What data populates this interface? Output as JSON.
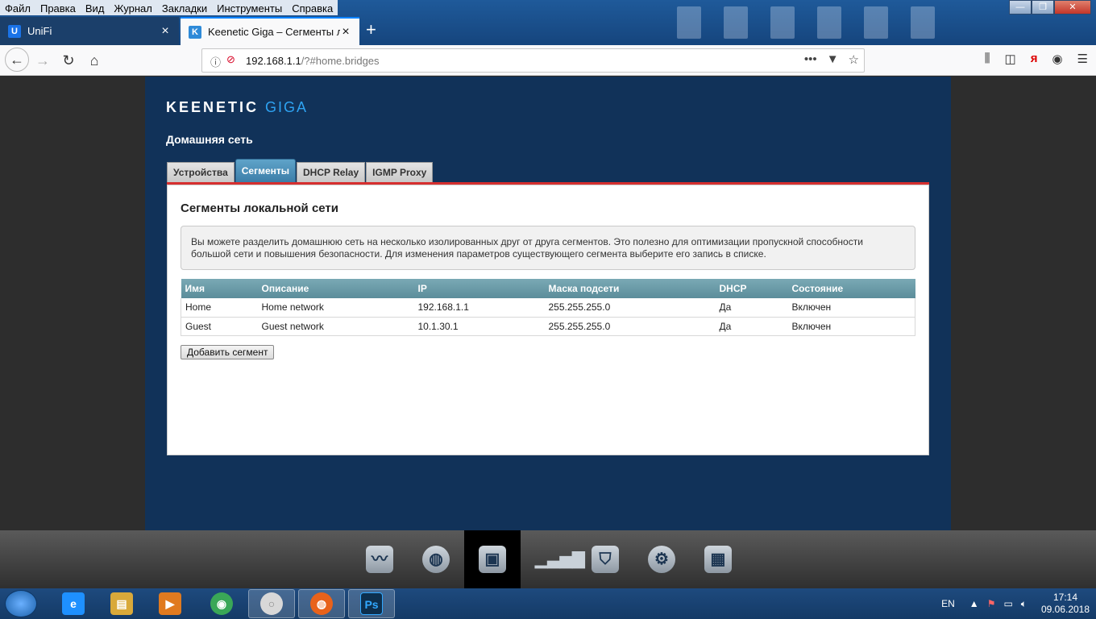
{
  "menubar": {
    "items": [
      "Файл",
      "Правка",
      "Вид",
      "Журнал",
      "Закладки",
      "Инструменты",
      "Справка"
    ]
  },
  "browser": {
    "tabs": [
      {
        "label": "UniFi",
        "icon": "unifi-icon",
        "icon_letter": "U",
        "icon_color": "#1a73e8",
        "active": false
      },
      {
        "label": "Keenetic Giga – Сегменты лока",
        "icon": "keenetic-icon",
        "icon_letter": "K",
        "icon_color": "#2e8ad8",
        "active": true
      }
    ],
    "url_host": "192.168.1.1",
    "url_path": "/?#home.bridges"
  },
  "router": {
    "logo_brand": "KEENETIC",
    "logo_model": "GIGA",
    "section_title": "Домашняя сеть",
    "tabs": [
      "Устройства",
      "Сегменты",
      "DHCP Relay",
      "IGMP Proxy"
    ],
    "active_tab": "Сегменты",
    "panel_title": "Сегменты локальной сети",
    "info_text": "Вы можете разделить домашнюю сеть на несколько изолированных друг от друга сегментов. Это полезно для оптимизации пропускной способности большой сети и повышения безопасности. Для изменения параметров существующего сегмента выберите его запись в списке.",
    "table": {
      "headers": [
        "Имя",
        "Описание",
        "IP",
        "Маска подсети",
        "DHCP",
        "Состояние"
      ],
      "rows": [
        [
          "Home",
          "Home network",
          "192.168.1.1",
          "255.255.255.0",
          "Да",
          "Включен"
        ],
        [
          "Guest",
          "Guest network",
          "10.1.30.1",
          "255.255.255.0",
          "Да",
          "Включен"
        ]
      ]
    },
    "add_button": "Добавить сегмент",
    "accent_color": "#d62f2f",
    "background_color": "#113259"
  },
  "dock": {
    "items": [
      {
        "name": "monitor-chart-icon",
        "active": false
      },
      {
        "name": "internet-globe-icon",
        "active": false
      },
      {
        "name": "home-network-icon",
        "active": true
      },
      {
        "name": "wifi-signal-icon",
        "active": false
      },
      {
        "name": "security-shield-icon",
        "active": false
      },
      {
        "name": "system-gear-icon",
        "active": false
      },
      {
        "name": "apps-grid-icon",
        "active": false
      }
    ]
  },
  "taskbar": {
    "apps": [
      {
        "name": "internet-explorer-icon",
        "letter": "e",
        "color": "#1e90ff",
        "open": false
      },
      {
        "name": "file-explorer-icon",
        "letter": "▤",
        "color": "#d9a93a",
        "open": false
      },
      {
        "name": "media-player-icon",
        "letter": "▶",
        "color": "#e07a1f",
        "open": false
      },
      {
        "name": "chrome-icon",
        "letter": "◉",
        "color": "#3aa757",
        "open": false
      },
      {
        "name": "unifi-app-icon",
        "letter": "○",
        "color": "#d8d8d8",
        "open": true
      },
      {
        "name": "firefox-icon",
        "letter": "◍",
        "color": "#e8621b",
        "open": true
      },
      {
        "name": "photoshop-icon",
        "letter": "Ps",
        "color": "#0d2f4d",
        "open": true
      }
    ],
    "lang": "EN",
    "time": "17:14",
    "date": "09.06.2018"
  }
}
